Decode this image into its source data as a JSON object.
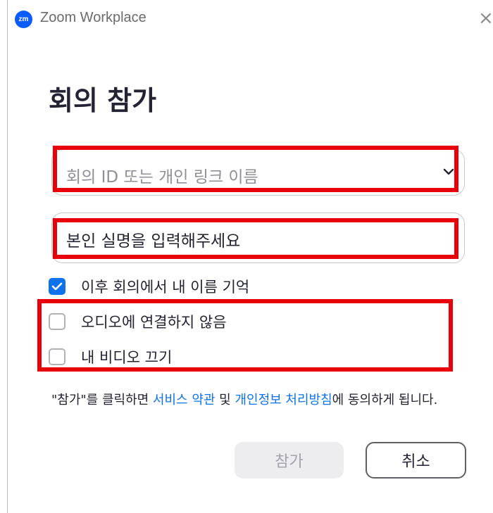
{
  "window": {
    "logo_text": "zm",
    "title": "Zoom Workplace",
    "close_glyph": "×"
  },
  "heading": "회의 참가",
  "meeting_id_field": {
    "placeholder": "회의 ID 또는 개인 링크 이름",
    "value": "",
    "icon": "chevron-down-icon"
  },
  "name_field": {
    "value": "본인 실명을 입력해주세요"
  },
  "options": [
    {
      "label": "이후 회의에서 내 이름 기억",
      "checked": true
    },
    {
      "label": "오디오에 연결하지 않음",
      "checked": false
    },
    {
      "label": "내 비디오 끄기",
      "checked": false
    }
  ],
  "terms": {
    "prefix": "\"참가\"를 클릭하면 ",
    "tos_link": "서비스 약관",
    "middle": " 및 ",
    "privacy_link": "개인정보 처리방침",
    "suffix": "에 동의하게 됩니다."
  },
  "buttons": {
    "join": "참가",
    "cancel": "취소"
  },
  "colors": {
    "accent": "#0e72ed",
    "highlight": "#e8000b",
    "disabled_bg": "#ededf0"
  }
}
